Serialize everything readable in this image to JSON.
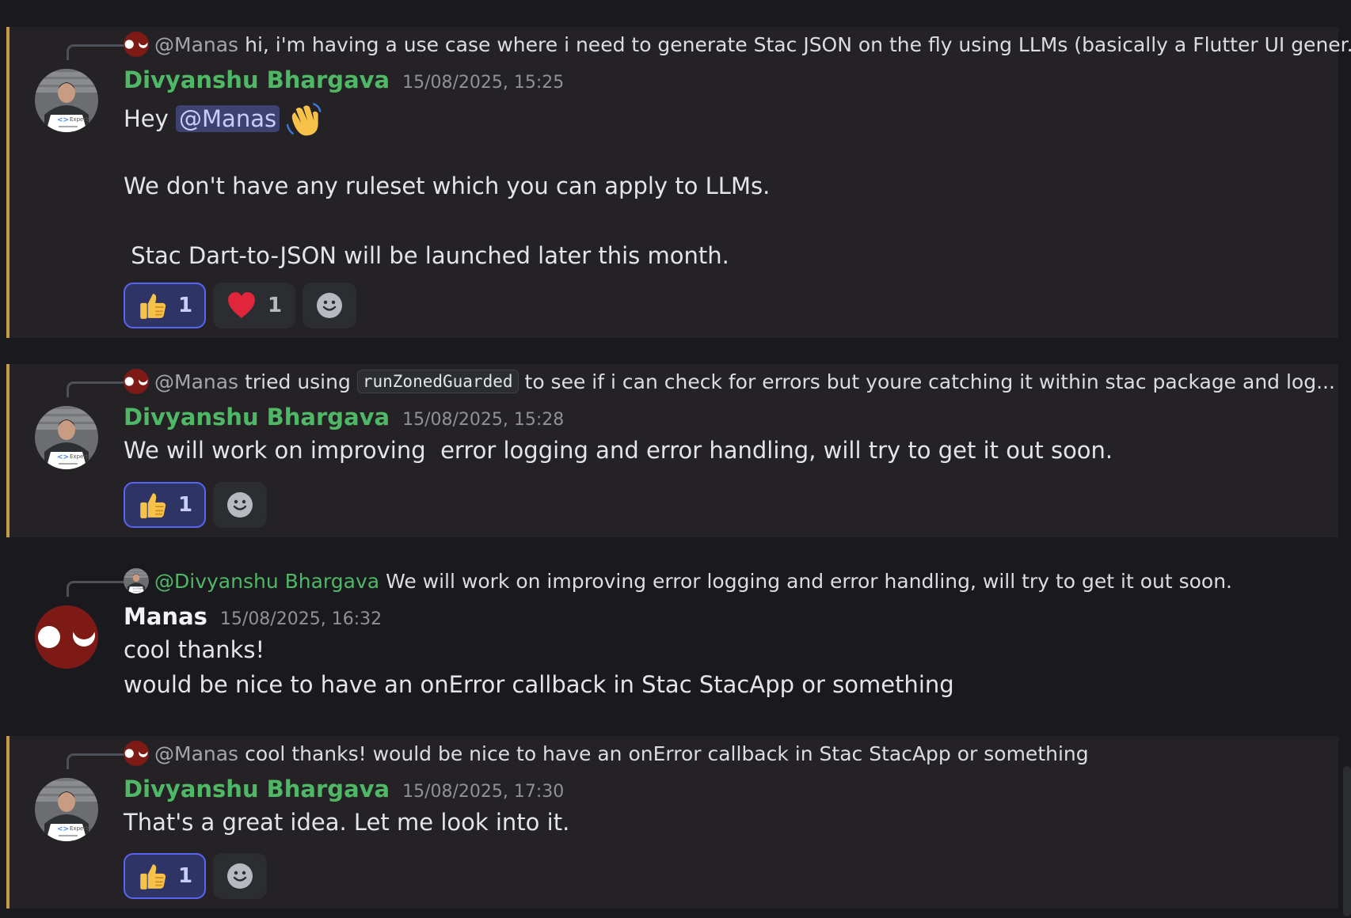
{
  "messages": [
    {
      "reply": {
        "name": "@Manas",
        "text": "hi, i'm having a use case where i need to generate Stac JSON on the fly using LLMs (basically a Flutter UI gener..."
      },
      "author": "Divyanshu Bhargava",
      "timestamp": "15/08/2025, 15:25",
      "body": {
        "line1_prefix": "Hey ",
        "line1_mention": "@Manas",
        "line1_emoji": "👋",
        "line2": "We don't have any ruleset which you can apply to LLMs.",
        "line3": " Stac Dart-to-JSON will be launched later this month."
      },
      "reactions": [
        {
          "emoji": "thumbs-up",
          "count": "1",
          "active": true
        },
        {
          "emoji": "heart",
          "count": "1",
          "active": false
        }
      ]
    },
    {
      "reply": {
        "name": "@Manas",
        "text_before": "tried using",
        "code": "runZonedGuarded",
        "text_after": "to see if i can check for errors but youre  catching it within stac package  and log..."
      },
      "author": "Divyanshu Bhargava",
      "timestamp": "15/08/2025, 15:28",
      "body": {
        "line1": "We will work on improving  error logging and error handling, will try to get it out soon."
      },
      "reactions": [
        {
          "emoji": "thumbs-up",
          "count": "1",
          "active": true
        }
      ]
    },
    {
      "reply": {
        "name": "@Divyanshu Bhargava",
        "text": "We will work on improving  error logging and error handling, will try to get it out soon."
      },
      "author": "Manas",
      "timestamp": "15/08/2025, 16:32",
      "body": {
        "line1": "cool thanks!",
        "line2": "would be nice to have an onError callback in Stac StacApp or something"
      },
      "reactions": []
    },
    {
      "reply": {
        "name": "@Manas",
        "text": "cool thanks! would be nice to have an onError callback in Stac StacApp or something"
      },
      "author": "Divyanshu Bhargava",
      "timestamp": "15/08/2025, 17:30",
      "body": {
        "line1": "That's a great idea. Let me look into it."
      },
      "reactions": [
        {
          "emoji": "thumbs-up",
          "count": "1",
          "active": true
        }
      ]
    }
  ],
  "avatar_text": "Experts",
  "icons": {
    "add_reaction": "smiley-face-icon",
    "thumbs_up": "thumbs-up-emoji",
    "heart": "heart-emoji",
    "wave": "waving-hand-emoji"
  },
  "colors": {
    "mention_bar": "#c59a46",
    "author_green": "#4fb866",
    "mention_pill": "#3d4270",
    "active_reaction_border": "#5865f2"
  }
}
